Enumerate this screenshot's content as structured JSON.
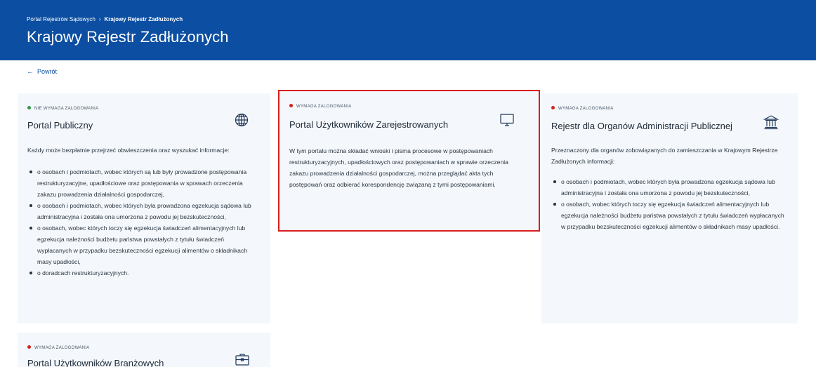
{
  "header": {
    "breadcrumb_root": "Portal Rejestrów Sądowych",
    "breadcrumb_separator": "›",
    "breadcrumb_current": "Krajowy Rejestr Zadłużonych",
    "title": "Krajowy Rejestr Zadłużonych"
  },
  "nav": {
    "back_label": "Powrót"
  },
  "colors": {
    "header_bg": "#0b4ea2",
    "card_bg": "#f4f8fc",
    "login_not_required": "#2e9a45",
    "login_required": "#d81e1e",
    "highlight_outline": "#d81e1e"
  },
  "cards": [
    {
      "badge": "NIE WYMAGA ZALOGOWANIA",
      "title": "Portal Publiczny",
      "icon": "globe-icon",
      "description": "Każdy może bezpłatnie przejrzeć obwieszczenia oraz wyszukać informacje:",
      "items": [
        "o osobach i podmiotach, wobec których są lub były prowadzone postępowania restrukturyzacyjne, upadłościowe oraz postępowania w sprawach orzeczenia zakazu prowadzenia działalności gospodarczej,",
        "o osobach i podmiotach, wobec których była prowadzona egzekucja sądowa lub administracyjna i została ona umorzona z powodu jej bezskuteczności,",
        "o osobach, wobec których toczy się egzekucja świadczeń alimentacyjnych lub egzekucja należności budżetu państwa powstałych z tytułu świadczeń wypłacanych w przypadku bezskuteczności egzekucji alimentów o składnikach masy upadłości,",
        "o doradcach restrukturyzacyjnych."
      ]
    },
    {
      "badge": "WYMAGA ZALOGOWANIA",
      "title": "Portal Użytkowników Zarejestrowanych",
      "icon": "monitor-icon",
      "description": "W tym portalu można składać wnioski i pisma procesowe w postępowaniach restrukturyzacyjnych, upadłościowych oraz postępowaniach w sprawie orzeczenia zakazu prowadzenia działalności gospodarczej, można przeglądać akta tych postępowań oraz odbierać korespondencję związaną z tymi postępowaniami."
    },
    {
      "badge": "WYMAGA ZALOGOWANIA",
      "title": "Rejestr dla Organów Administracji Publicznej",
      "icon": "institution-icon",
      "description": "Przeznaczony dla organów zobowiązanych do zamieszczania w Krajowym Rejestrze Zadłużonych informacji:",
      "items": [
        "o osobach i podmiotach, wobec których była prowadzona egzekucja sądowa lub administracyjna i została ona umorzona z powodu jej bezskuteczności,",
        "o osobach, wobec których toczy się egzekucja świadczeń alimentacyjnych lub egzekucja należności budżetu państwa powstałych z tytułu świadczeń wypłacanych w przypadku bezskuteczności egzekucji alimentów o składnikach masy upadłości."
      ]
    },
    {
      "badge": "WYMAGA ZALOGOWANIA",
      "title": "Portal Użytkowników Branżowych",
      "icon": "briefcase-icon"
    }
  ]
}
